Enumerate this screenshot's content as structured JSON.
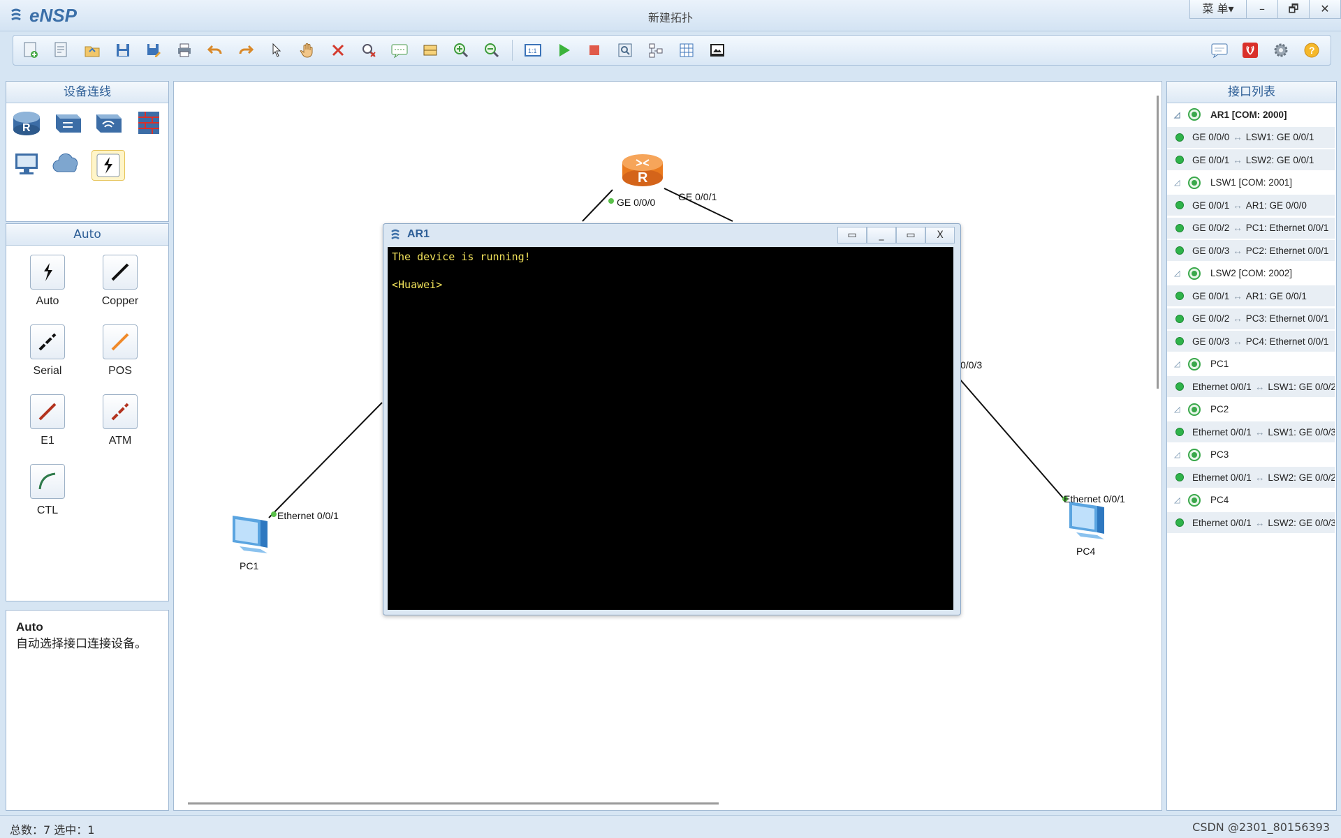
{
  "app": {
    "logo_text": "eNSP",
    "window_title": "新建拓扑",
    "menu_label": "菜 单▾",
    "minimize": "–",
    "restore": "🗗",
    "close": "✕"
  },
  "toolbar": {
    "left_icons": [
      "new-topology-icon",
      "new-example-icon",
      "open-icon",
      "save-icon",
      "save-as-icon",
      "print-icon",
      "undo-icon",
      "redo-icon",
      "select-icon",
      "pan-hand-icon",
      "delete-icon",
      "delete-all-links-icon",
      "add-note-icon",
      "add-shape-icon",
      "zoom-in-icon",
      "zoom-out-icon",
      "fit-icon",
      "start-device-icon",
      "stop-device-icon",
      "capture-icon",
      "topology-icon",
      "grid-icon",
      "background-icon"
    ],
    "right_icons": [
      "chat-icon",
      "huawei-icon",
      "settings-icon",
      "help-icon"
    ]
  },
  "left_panel": {
    "title": "设备连线",
    "devices": [
      "router-icon",
      "switch-icon",
      "wlan-icon",
      "firewall-icon",
      "pc-icon",
      "cloud-icon",
      "link-icon"
    ],
    "links_title": "Auto",
    "links": [
      {
        "label": "Auto",
        "icon": "auto-link-icon"
      },
      {
        "label": "Copper",
        "icon": "copper-link-icon"
      },
      {
        "label": "Serial",
        "icon": "serial-link-icon"
      },
      {
        "label": "POS",
        "icon": "pos-link-icon"
      },
      {
        "label": "E1",
        "icon": "e1-link-icon"
      },
      {
        "label": "ATM",
        "icon": "atm-link-icon"
      },
      {
        "label": "CTL",
        "icon": "ctl-link-icon"
      }
    ],
    "help_title": "Auto",
    "help_text": "自动选择接口连接设备。"
  },
  "canvas": {
    "router_label_left": "GE 0/0/0",
    "router_label_right": "GE 0/0/1",
    "pc1_label": "PC1",
    "pc1_port": "Ethernet 0/0/1",
    "pc4_label": "PC4",
    "pc4_port": "Ethernet 0/0/1",
    "switch_port": "0/0/3"
  },
  "console": {
    "title": "AR1",
    "lines": [
      "The device is running!",
      "",
      "<Huawei>"
    ],
    "btn_a": "▭",
    "btn_min": "_",
    "btn_max": "▭",
    "btn_close": "X"
  },
  "interface_list": {
    "title": "接口列表",
    "rows": [
      {
        "type": "device",
        "label": "AR1 [COM: 2000]"
      },
      {
        "type": "link",
        "left": "GE 0/0/0",
        "right": "LSW1: GE 0/0/1"
      },
      {
        "type": "link",
        "left": "GE 0/0/1",
        "right": "LSW2: GE 0/0/1"
      },
      {
        "type": "device",
        "label": "LSW1 [COM: 2001]"
      },
      {
        "type": "link",
        "left": "GE 0/0/1",
        "right": "AR1: GE 0/0/0"
      },
      {
        "type": "link",
        "left": "GE 0/0/2",
        "right": "PC1: Ethernet 0/0/1"
      },
      {
        "type": "link",
        "left": "GE 0/0/3",
        "right": "PC2: Ethernet 0/0/1"
      },
      {
        "type": "device",
        "label": "LSW2 [COM: 2002]"
      },
      {
        "type": "link",
        "left": "GE 0/0/1",
        "right": "AR1: GE 0/0/1"
      },
      {
        "type": "link",
        "left": "GE 0/0/2",
        "right": "PC3: Ethernet 0/0/1"
      },
      {
        "type": "link",
        "left": "GE 0/0/3",
        "right": "PC4: Ethernet 0/0/1"
      },
      {
        "type": "device",
        "label": "PC1"
      },
      {
        "type": "link",
        "left": "Ethernet 0/0/1",
        "right": "LSW1: GE 0/0/2"
      },
      {
        "type": "device",
        "label": "PC2"
      },
      {
        "type": "link",
        "left": "Ethernet 0/0/1",
        "right": "LSW1: GE 0/0/3"
      },
      {
        "type": "device",
        "label": "PC3"
      },
      {
        "type": "link",
        "left": "Ethernet 0/0/1",
        "right": "LSW2: GE 0/0/2"
      },
      {
        "type": "device",
        "label": "PC4"
      },
      {
        "type": "link",
        "left": "Ethernet 0/0/1",
        "right": "LSW2: GE 0/0/3"
      }
    ]
  },
  "status": {
    "left": "总数：7  选中：1",
    "right": "CSDN @2301_80156393"
  }
}
